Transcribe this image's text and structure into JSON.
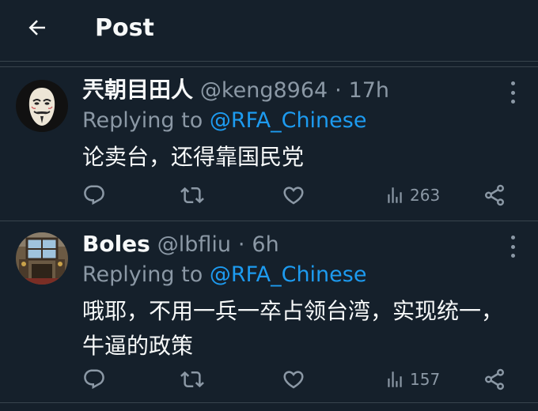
{
  "header": {
    "title": "Post"
  },
  "tweets": [
    {
      "display_name": "兲朝目田人",
      "handle": "@keng8964",
      "separator": "·",
      "timestamp": "17h",
      "replying_prefix": "Replying to",
      "replying_to": "@RFA_Chinese",
      "text": "论卖台，还得靠国民党",
      "views": "263",
      "avatar_icon": "guy-fawkes-mask-avatar"
    },
    {
      "display_name": "Boles",
      "handle": "@lbfliu",
      "separator": "·",
      "timestamp": "6h",
      "replying_prefix": "Replying to",
      "replying_to": "@RFA_Chinese",
      "text": "哦耶，不用一兵一卒占领台湾，实现统一，牛逼的政策",
      "views": "157",
      "avatar_icon": "building-interior-avatar"
    }
  ],
  "icons": {
    "back": "arrow-left-icon",
    "more": "more-vertical-icon",
    "reply": "comment-icon",
    "retweet": "retweet-icon",
    "like": "heart-icon",
    "views": "bar-chart-icon",
    "share": "share-icon"
  },
  "colors": {
    "background": "#15202b",
    "text_primary": "#f7f9f9",
    "text_secondary": "#8b98a5",
    "accent": "#1d9bf0",
    "divider": "#38444d"
  }
}
